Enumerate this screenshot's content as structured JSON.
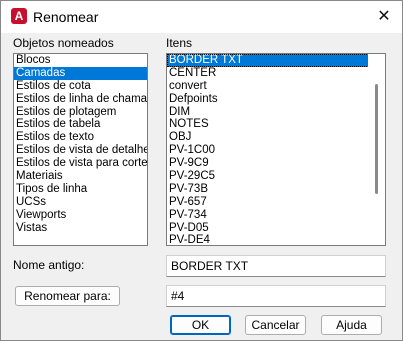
{
  "window": {
    "title": "Renomear",
    "app_icon_letter": "A",
    "close_glyph": "✕"
  },
  "named_objects": {
    "label": "Objetos nomeados",
    "items": [
      "Blocos",
      "Camadas",
      "Estilos de cota",
      "Estilos de linha de chamada",
      "Estilos de plotagem",
      "Estilos de tabela",
      "Estilos de texto",
      "Estilos de vista de detalhe",
      "Estilos de vista para corte",
      "Materiais",
      "Tipos de linha",
      "UCSs",
      "Viewports",
      "Vistas"
    ],
    "selected": "Camadas"
  },
  "items_list": {
    "label": "Itens",
    "items": [
      "BORDER TXT",
      "CENTER",
      "convert",
      "Defpoints",
      "DIM",
      "NOTES",
      "OBJ",
      "PV-1C00",
      "PV-9C9",
      "PV-29C5",
      "PV-73B",
      "PV-657",
      "PV-734",
      "PV-D05",
      "PV-DE4"
    ],
    "selected": "BORDER TXT"
  },
  "old_name": {
    "label": "Nome antigo:",
    "value": "BORDER TXT"
  },
  "rename_to": {
    "button_label": "Renomear para:",
    "value": "#4"
  },
  "buttons": {
    "ok": "OK",
    "cancel": "Cancelar",
    "help": "Ajuda"
  }
}
